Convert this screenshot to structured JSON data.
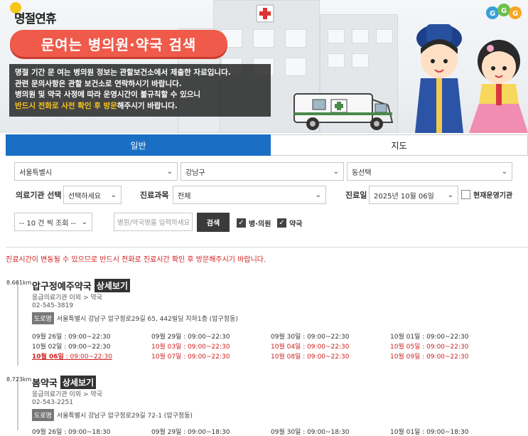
{
  "banner": {
    "logo": "명절연휴",
    "title": "문여는 병의원·약국 검색",
    "notice_1": "명절 기간 문 여는 병의원 정보는 관할보건소에서 제출한 자료입니다.",
    "notice_2": "관련 문의사항은 관할 보건소로 연락하시기 바랍니다.",
    "notice_3": "병의원 및 약국 사정에 따라 운영시간이 불규칙할 수 있으니",
    "notice_4_highlight": "반드시 전화로 사전 확인 후 방문",
    "notice_4_rest": "해주시기 바랍니다.",
    "accent_color": "#ef5a4a"
  },
  "tabs": [
    {
      "label": "일반",
      "active": true
    },
    {
      "label": "지도",
      "active": false
    }
  ],
  "filters": {
    "city": "서울특별시",
    "district": "강남구",
    "dong": "동선택",
    "facility_label": "의료기관 선택",
    "facility_value": "선택하세요",
    "department_label": "진료과목",
    "department_value": "전체",
    "date_label": "진료일",
    "date_value": "2025년 10월 06일",
    "open_now_label": "현재운영기관",
    "page_size": "-- 10 건 씩 조회 --",
    "search_placeholder": "병원/약국명을 입력하세요",
    "search_button": "검색",
    "hospital_label": "병·의원",
    "pharmacy_label": "약국"
  },
  "warning": "진료시간이 변동될 수 있으므로 반드시 전화로 진료시간 확인 후 방문해주시기 바랍니다.",
  "detail_label": "상세보기",
  "road_label": "도로명",
  "results": [
    {
      "distance": "8.661km",
      "name": "압구정예주약국",
      "category": "응급의료기관 이외 > 약국",
      "phone": "02-545-3819",
      "address": "서울특별시 강남구 압구정로29길 65, 442빌딩 지하1층 (압구정동)",
      "hours": [
        {
          "date": "09월 26일",
          "time": "09:00~22:30",
          "style": "normal"
        },
        {
          "date": "09월 29일",
          "time": "09:00~22:30",
          "style": "normal"
        },
        {
          "date": "09월 30일",
          "time": "09:00~22:30",
          "style": "normal"
        },
        {
          "date": "10월 01일",
          "time": "09:00~22:30",
          "style": "normal"
        },
        {
          "date": "10월 02일",
          "time": "09:00~22:30",
          "style": "normal"
        },
        {
          "date": "10월 03일",
          "time": "09:00~22:30",
          "style": "red"
        },
        {
          "date": "10월 04일",
          "time": "09:00~22:30",
          "style": "red"
        },
        {
          "date": "10월 05일",
          "time": "09:00~22:30",
          "style": "red"
        },
        {
          "date": "10월 06일",
          "time": "09:00~22:30",
          "style": "today"
        },
        {
          "date": "10월 07일",
          "time": "09:00~22:30",
          "style": "red"
        },
        {
          "date": "10월 08일",
          "time": "09:00~22:30",
          "style": "red"
        },
        {
          "date": "10월 09일",
          "time": "09:00~22:30",
          "style": "red"
        }
      ]
    },
    {
      "distance": "8.723km",
      "name": "봄약국",
      "category": "응급의료기관 이외 > 약국",
      "phone": "02-543-2251",
      "address": "서울특별시 강남구 압구정로29길 72-1 (압구정동)",
      "hours": [
        {
          "date": "09월 26일",
          "time": "09:00~18:30",
          "style": "normal"
        },
        {
          "date": "09월 29일",
          "time": "09:00~18:30",
          "style": "normal"
        },
        {
          "date": "09월 30일",
          "time": "09:00~18:30",
          "style": "normal"
        },
        {
          "date": "10월 01일",
          "time": "09:00~18:30",
          "style": "normal"
        }
      ]
    }
  ]
}
